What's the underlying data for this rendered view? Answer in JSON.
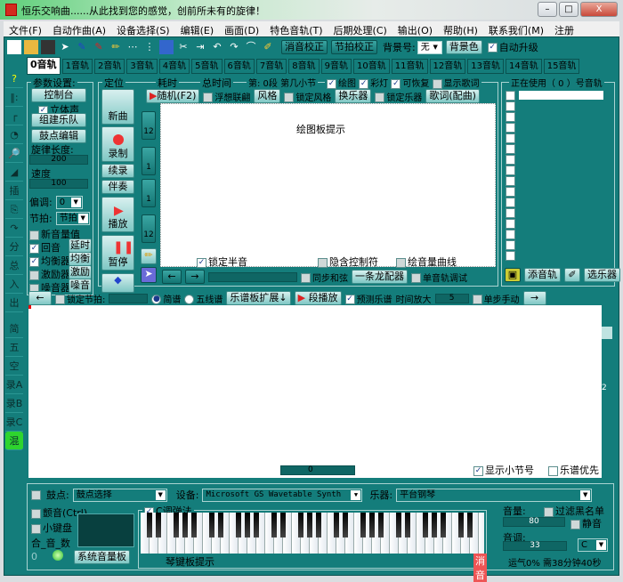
{
  "window": {
    "title": "恒乐交响曲......从此找到您的感觉，创前所未有的旋律！",
    "min": "–",
    "max": "□",
    "close": "X"
  },
  "menu": [
    "文件(F)",
    "自动作曲(A)",
    "设备选择(S)",
    "编辑(E)",
    "画面(D)",
    "特色音轨(T)",
    "后期处理(C)",
    "输出(O)",
    "帮助(H)",
    "联系我们(M)",
    "注册"
  ],
  "toolbar": {
    "noise_fix": "消音校正",
    "beat_fix": "节拍校正",
    "bg_label": "背景号:",
    "bg_value": "无",
    "bg_color": "背景色",
    "auto_upgrade": "自动升级"
  },
  "tabs": [
    "0音轨",
    "1音轨",
    "2音轨",
    "3音轨",
    "4音轨",
    "5音轨",
    "6音轨",
    "7音轨",
    "8音轨",
    "9音轨",
    "10音轨",
    "11音轨",
    "12音轨",
    "13音轨",
    "14音轨",
    "15音轨"
  ],
  "left_icons": [
    "?",
    "‖:",
    "┌",
    "◔",
    "🔎",
    "◢",
    "插",
    "⎘",
    "↷",
    "分",
    "总",
    "入",
    "出",
    "简",
    "五",
    "空",
    "录A",
    "录B",
    "录C",
    "混"
  ],
  "params": {
    "title": "参数设置:",
    "console": "控制台",
    "stereo": "立体声",
    "band": "组建乐队",
    "drum_edit": "鼓点编辑",
    "melody_len": "旋律长度:",
    "melody_val": "200",
    "speed": "速度",
    "speed_val": "100",
    "key_label": "偏调:",
    "key_val": "0",
    "beat_label": "节拍:",
    "beat_val": "节拍",
    "new_vol": "新音量值",
    "echo": "回音",
    "delay": "延时",
    "eq": "均衡器",
    "eq_btn": "均衡",
    "exciter": "激励器",
    "exciter_btn": "激励",
    "noise": "噪音器",
    "noise_btn": "噪音"
  },
  "controls": {
    "locate": "定位",
    "new": "新曲",
    "record": "录制",
    "continue": "续录",
    "accompany": "伴奏",
    "play": "播放",
    "pause": "暂停",
    "up12": "12",
    "up1": "1",
    "down1": "1",
    "down12": "12"
  },
  "header": {
    "elapsed": "耗时",
    "total": "总时间",
    "segment": "第: 0段 第几小节",
    "draw": "绘图",
    "lights": "彩灯",
    "recoverable": "可恢复",
    "show_lyrics": "显示歌词"
  },
  "row2": {
    "random": "随机(F2)",
    "assoc": "浮想联翩",
    "style": "风格",
    "lock_style": "锁定风格",
    "change_inst": "换乐器",
    "lock_inst": "锁定乐器",
    "lyrics": "歌词(配曲)"
  },
  "canvas": {
    "hint": "绘图板提示",
    "lock_semitone": "锁定半音",
    "hidden_ctrl": "隐含控制符",
    "draw_vol": "绘音量曲线"
  },
  "row3": {
    "sync_chord": "同步和弦",
    "dragon": "一条龙配器",
    "single_debug": "单音轨调试"
  },
  "tracks": {
    "title": "正在使用（ 0 ）号音轨",
    "add": "添音轨",
    "choose": "选乐器"
  },
  "score_bar": {
    "lock_beat": "锁定节拍:",
    "jianpu": "简谱",
    "staff": "五线谱",
    "expand": "乐谱板扩展↓",
    "seg_play": "段播放",
    "predict": "预测乐谱",
    "zoom": "时间放大",
    "zoom_val": "5",
    "step": "单步手动"
  },
  "score": {
    "scroll_val": "0",
    "show_bar": "显示小节号",
    "score_first": "乐谱优先",
    "side": "2"
  },
  "bottom": {
    "drum": "鼓点:",
    "drum_sel": "鼓点选择",
    "device_label": "设备:",
    "device": "Microsoft GS Wavetable Synth",
    "inst_label": "乐器:",
    "inst": "平台钢琴",
    "tremolo": "颤音(Ctrl)",
    "mini_kb": "小键盘",
    "chord": "合_音_数",
    "zero": "0",
    "c_play": "C调弹法",
    "sys_vol": "系统音量板",
    "kb_hint": "琴键板提示",
    "mute_btn": "消音",
    "volume": "音量:",
    "filter": "过滤黑名单",
    "vol_val": "80",
    "mute": "静音",
    "pitch": "音调:",
    "pitch_val": "33",
    "pitch_key": "C",
    "status": "运气0% 需38分钟40秒"
  }
}
